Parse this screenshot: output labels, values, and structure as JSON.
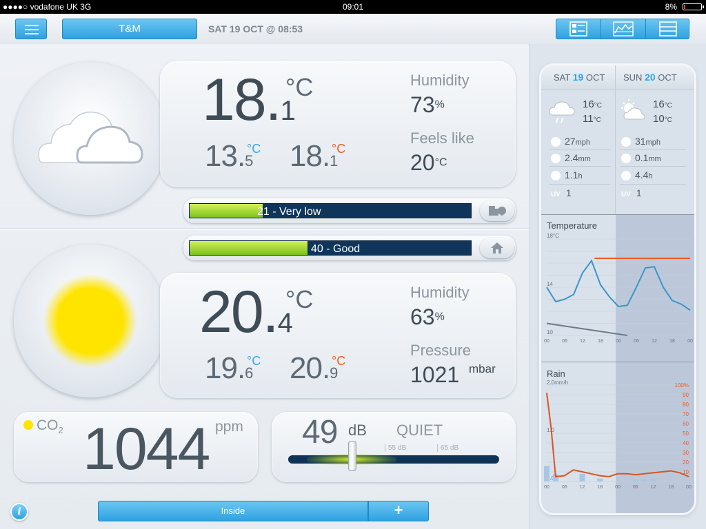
{
  "status_bar": {
    "carrier": "●●●●○ vodafone UK   3G",
    "time": "09:01",
    "battery": "8%",
    "battery_level": 0.08
  },
  "toolbar": {
    "station_name": "T&M",
    "date": "SAT 19 OCT @ 08:53"
  },
  "outdoor": {
    "weather_icon": "cloud-icon",
    "temp_int": "18.",
    "temp_dec": "1",
    "unit": "°C",
    "min_int": "13.",
    "min_dec": "5",
    "min_unit": "°C",
    "max_int": "18.",
    "max_dec": "1",
    "max_unit": "°C",
    "humidity_label": "Humidity",
    "humidity_value": "73",
    "humidity_unit": "%",
    "feels_label": "Feels like",
    "feels_value": "20",
    "feels_unit": "°C",
    "air_quality_text": "21 - Very low",
    "air_quality_level": 0.26
  },
  "indoor": {
    "weather_icon": "sun-icon",
    "air_quality_text": "40 - Good",
    "air_quality_level": 0.42,
    "temp_int": "20.",
    "temp_dec": "4",
    "unit": "°C",
    "min_int": "19.",
    "min_dec": "6",
    "min_unit": "°C",
    "max_int": "20.",
    "max_dec": "9",
    "max_unit": "°C",
    "humidity_label": "Humidity",
    "humidity_value": "63",
    "humidity_unit": "%",
    "pressure_label": "Pressure",
    "pressure_value": "1021",
    "pressure_unit": "mbar",
    "co2_label": "CO",
    "co2_sub": "2",
    "co2_value": "1044",
    "co2_unit": "ppm",
    "noise_value": "49",
    "noise_unit": "dB",
    "noise_label": "QUIET",
    "noise_tick1": "55 dB",
    "noise_tick2": "65 dB",
    "noise_level": 0.3
  },
  "forecast": {
    "days": [
      {
        "day": "SAT",
        "num": "19",
        "month": "OCT",
        "icon": "rain-cloud-icon",
        "high": "16",
        "low": "11",
        "unit": "°C",
        "wind": "27",
        "wind_unit": "mph",
        "rain": "2.4",
        "rain_unit": "mm",
        "sun": "1.1",
        "sun_unit": "h",
        "uv_label": "UV",
        "uv": "1"
      },
      {
        "day": "SUN",
        "num": "20",
        "month": "OCT",
        "icon": "sun-cloud-icon",
        "high": "16",
        "low": "10",
        "unit": "°C",
        "wind": "31",
        "wind_unit": "mph",
        "rain": "0.1",
        "rain_unit": "mm",
        "sun": "4.4",
        "sun_unit": "h",
        "uv_label": "UV",
        "uv": "1"
      }
    ]
  },
  "colors": {
    "accent_blue": "#2fa1e0",
    "max_red": "#f15a24",
    "min_blue": "#3fa7da",
    "sun_yellow": "#ffe400",
    "bar_dark": "#10355a"
  },
  "chart_data": [
    {
      "type": "line",
      "title": "Temperature",
      "ylabel_top": "18°C",
      "yticks": [
        "18°C",
        "14",
        "10"
      ],
      "x_ticks": [
        "00",
        "06",
        "12",
        "18",
        "00",
        "06",
        "12",
        "18",
        "00"
      ],
      "ylim": [
        10,
        18
      ],
      "series": [
        {
          "name": "",
          "color": "#3a95c8",
          "x": [
            0,
            3,
            6,
            9,
            12,
            15,
            18,
            21,
            24,
            27,
            30,
            33,
            36,
            39,
            42,
            45,
            48
          ],
          "y": [
            14.0,
            12.8,
            13.0,
            13.4,
            15.2,
            16.2,
            14.2,
            13.2,
            12.4,
            12.5,
            14.0,
            15.6,
            15.7,
            14.0,
            12.9,
            12.6,
            12.1
          ]
        },
        {
          "name": "",
          "color": "#f15a24",
          "x": [
            16,
            48
          ],
          "y": [
            16.4,
            16.4
          ]
        },
        {
          "name": "",
          "color": "#6a7a88",
          "x": [
            0,
            27
          ],
          "y": [
            11.0,
            10.0
          ]
        }
      ]
    },
    {
      "type": "line",
      "title": "Rain",
      "ylabel_top": "2.0mm/h",
      "yticks_left": [
        "2.0mm/h",
        "1.0",
        "0.0"
      ],
      "yticks_right": [
        "100%",
        "90",
        "80",
        "70",
        "60",
        "50",
        "40",
        "30",
        "20",
        "10"
      ],
      "x_ticks": [
        "00",
        "06",
        "12",
        "18",
        "00",
        "06",
        "12",
        "18",
        "00"
      ],
      "ylim": [
        0,
        2.0
      ],
      "series": [
        {
          "name": "",
          "color": "#d9541e",
          "axis": "right",
          "x": [
            0,
            1.5,
            3,
            6,
            9,
            12,
            15,
            18,
            21,
            24,
            27,
            30,
            33,
            36,
            39,
            42,
            45,
            48
          ],
          "y": [
            92,
            55,
            5,
            6,
            12,
            10,
            8,
            6,
            5,
            8,
            8,
            7,
            8,
            9,
            10,
            11,
            9,
            5
          ]
        },
        {
          "name": "",
          "color": "#a9c6e4",
          "type": "bar",
          "x": [
            0,
            3,
            12,
            18,
            30,
            33,
            36
          ],
          "y": [
            0.32,
            0.16,
            0.16,
            0.06,
            0.04,
            0.04,
            0.06
          ]
        }
      ]
    }
  ]
}
